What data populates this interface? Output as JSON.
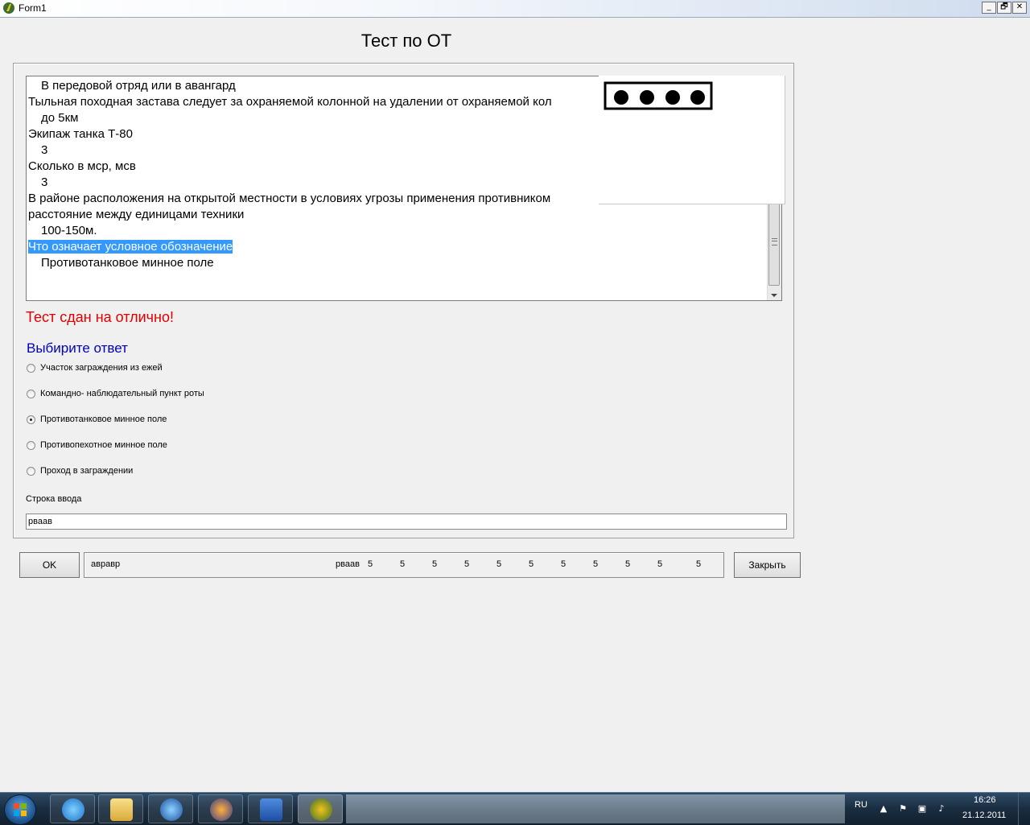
{
  "window": {
    "title": "Form1",
    "controls": {
      "minimize": "_",
      "maximize": "🗗",
      "close": "✕"
    }
  },
  "heading": "Тест по ОТ",
  "memo": {
    "lines": [
      {
        "text": "В передовой отряд или в авангард",
        "indent": true
      },
      {
        "text": "Тыльная походная застава следует за охраняемой колонной на удалении от охраняемой кол",
        "indent": false
      },
      {
        "text": "до 5км",
        "indent": true
      },
      {
        "text": "Экипаж танка Т-80",
        "indent": false
      },
      {
        "text": "3",
        "indent": true
      },
      {
        "text": "Сколько в мср, мсв",
        "indent": false
      },
      {
        "text": "3",
        "indent": true
      },
      {
        "text": "В районе расположения на открытой местности в условиях угрозы применения противником",
        "indent": false
      },
      {
        "text": "расстояние между единицами техники",
        "indent": false
      },
      {
        "text": "100-150м.",
        "indent": true
      },
      {
        "text": "Что означает условное обозначение",
        "indent": false,
        "selected": true
      },
      {
        "text": "Противотанковое минное поле",
        "indent": true
      }
    ]
  },
  "image": {
    "description_icon": "antitank-minefield-symbol",
    "dots": 4
  },
  "result_text": "Тест сдан на отлично!",
  "choose_label": "Выбирите ответ",
  "options": [
    {
      "label": "Участок заграждения  из ежей",
      "checked": false
    },
    {
      "label": "Командно- наблюдательный пункт роты",
      "checked": false
    },
    {
      "label": "Противотанковое минное поле",
      "checked": true
    },
    {
      "label": "Противопехотное минное поле",
      "checked": false
    },
    {
      "label": "Проход в заграждении",
      "checked": false
    }
  ],
  "input": {
    "label": "Строка ввода",
    "value": "рваав"
  },
  "buttons": {
    "ok": "OK",
    "close": "Закрыть"
  },
  "status": {
    "left": "авравр",
    "name": "рваав",
    "scores": [
      "5",
      "5",
      "5",
      "5",
      "5",
      "5",
      "5",
      "5",
      "5",
      "5",
      "5"
    ]
  },
  "taskbar": {
    "language": "RU",
    "time": "16:26",
    "date": "21.12.2011"
  }
}
